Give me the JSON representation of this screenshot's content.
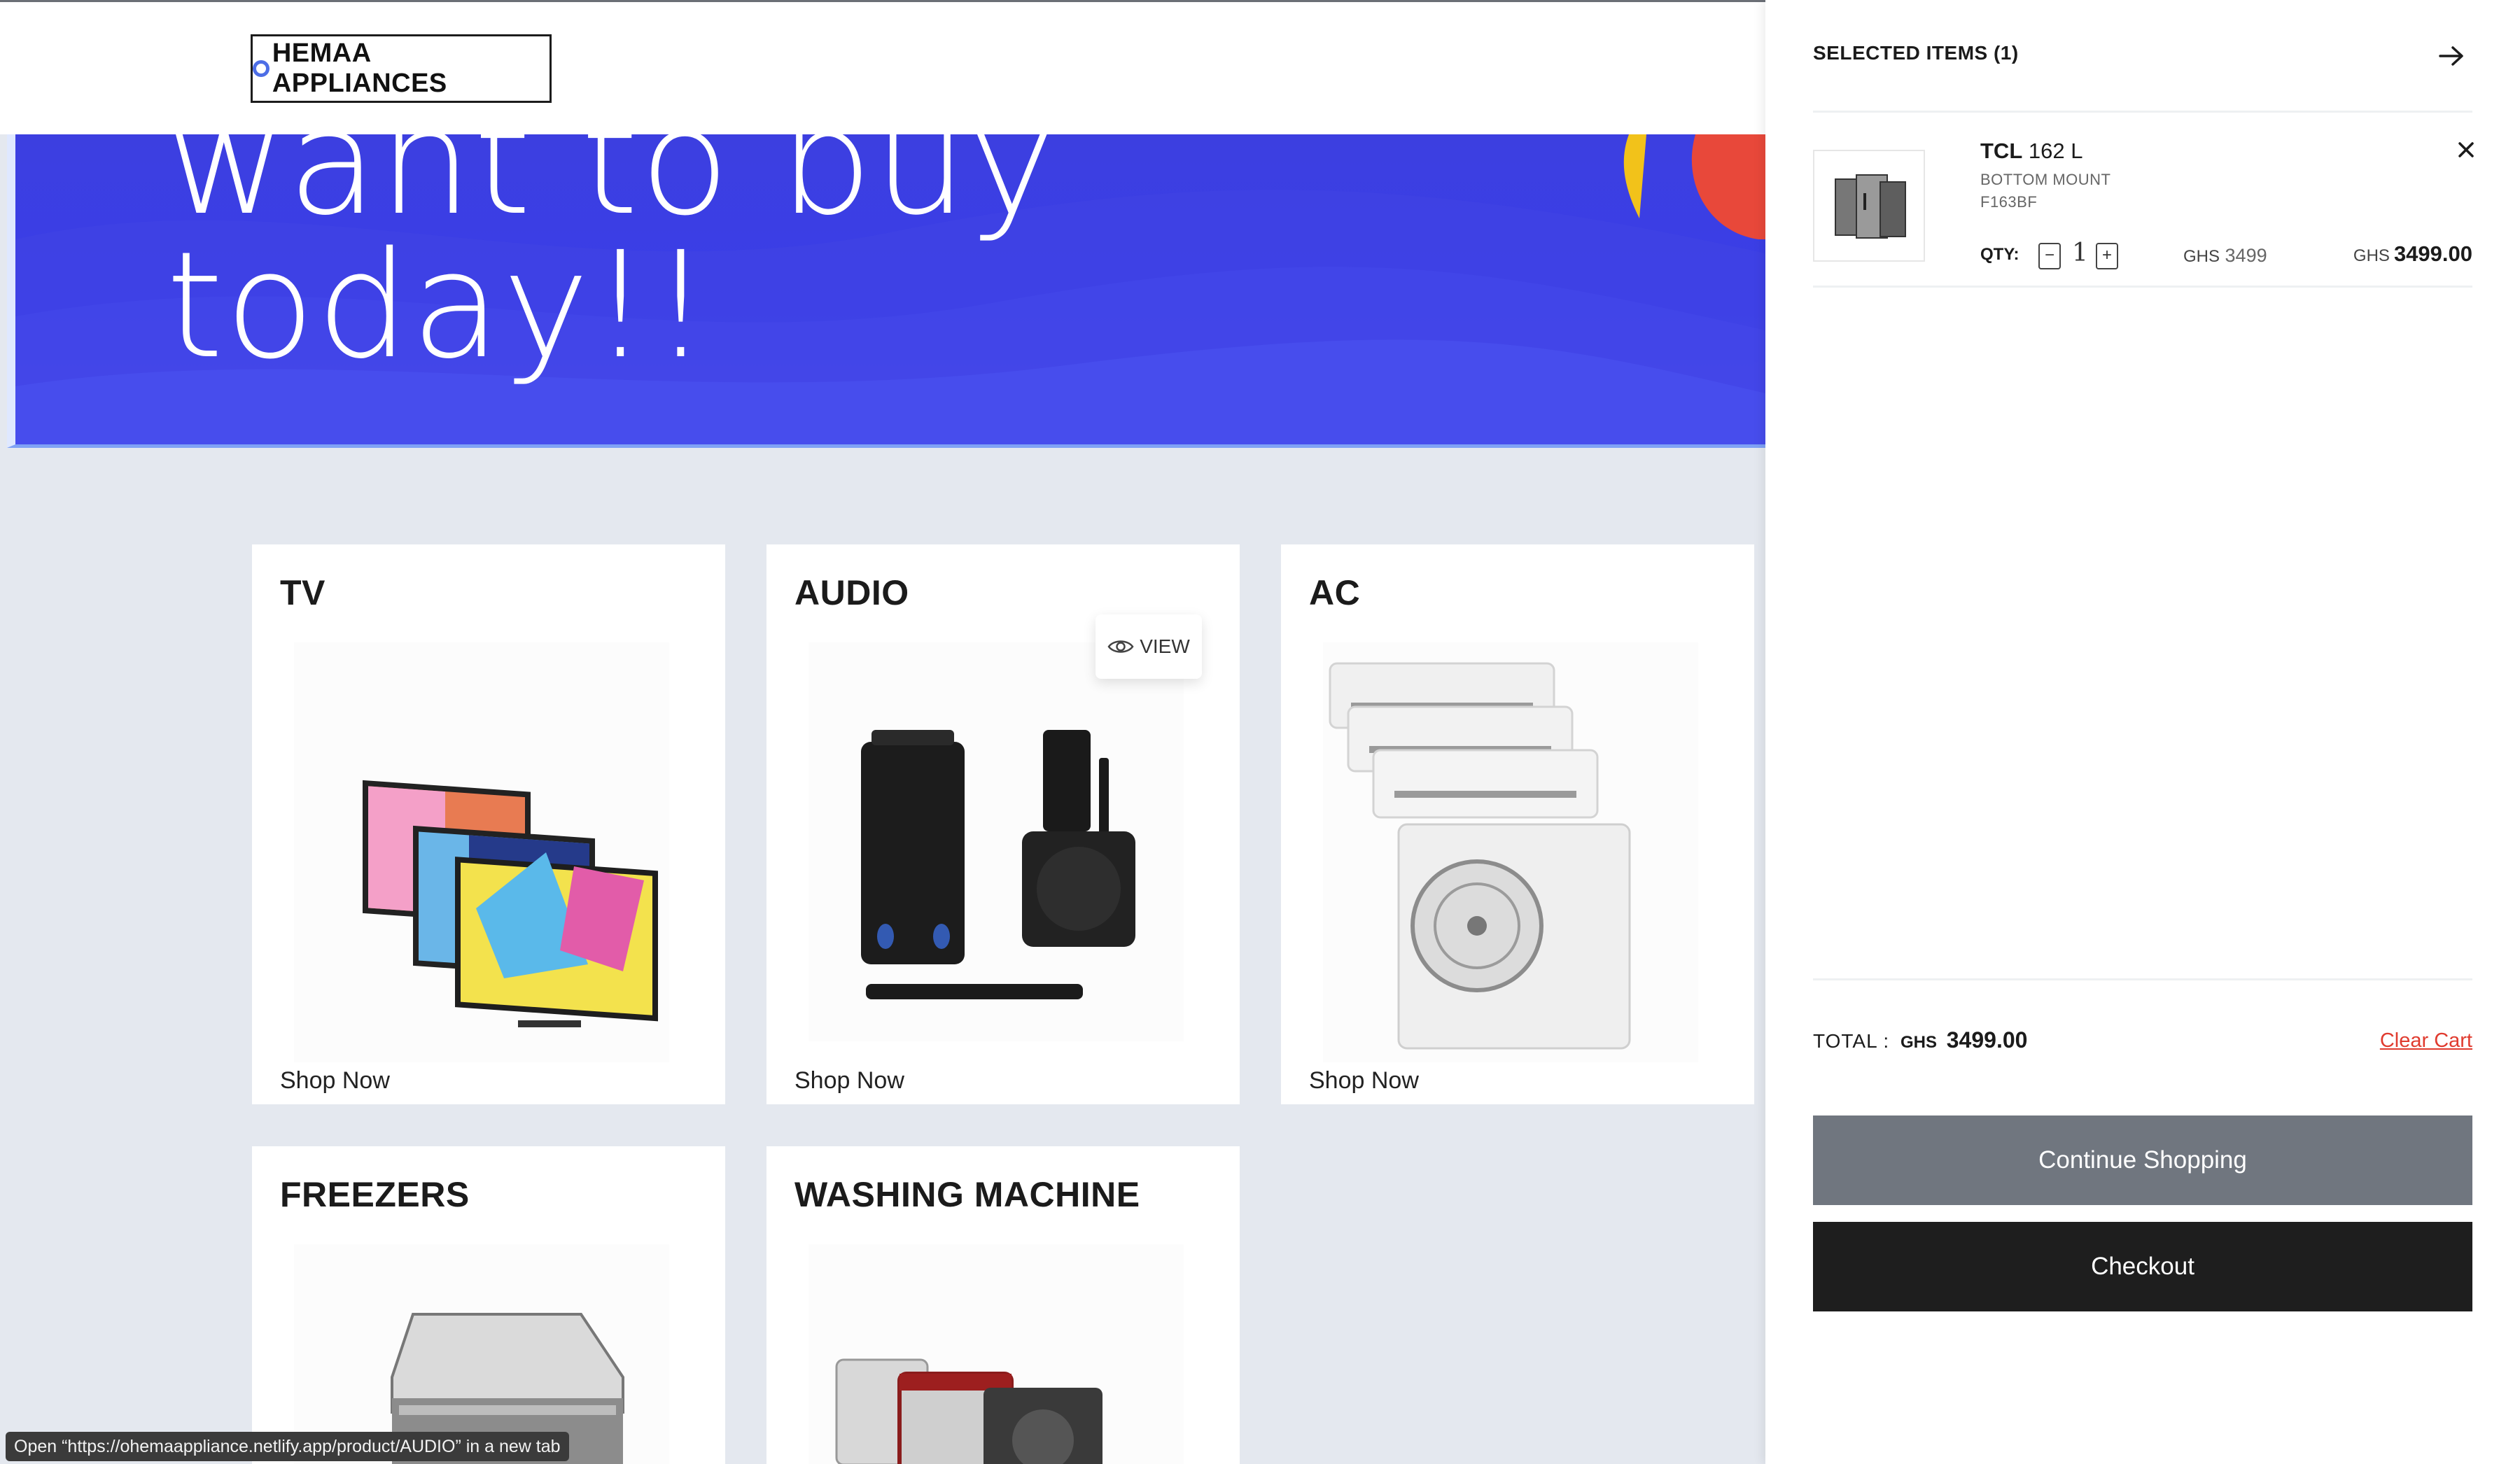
{
  "header": {
    "logo_text": "HEMAA APPLIANCES"
  },
  "hero": {
    "line1": "want to buy",
    "line2": "today!!"
  },
  "categories": [
    {
      "title": "TV",
      "cta": "Shop Now"
    },
    {
      "title": "AUDIO",
      "cta": "Shop Now"
    },
    {
      "title": "AC",
      "cta": "Shop Now"
    },
    {
      "title": "FREEZERS",
      "cta": ""
    },
    {
      "title": "WASHING MACHINE",
      "cta": ""
    }
  ],
  "quick_view": {
    "label": "VIEW"
  },
  "status_bar": {
    "text": "Open “https://ohemaappliance.netlify.app/product/AUDIO” in a new tab"
  },
  "cart": {
    "heading": "SELECTED ITEMS (1)",
    "item": {
      "brand": "TCL",
      "model": " 162 L",
      "sub1": "BOTTOM MOUNT",
      "sub2": "F163BF",
      "qty_label": "QTY:",
      "qty_minus": "−",
      "qty": "1",
      "qty_plus": "+",
      "currency": "GHS",
      "unit_price": "3499",
      "line_total": "3499.00"
    },
    "total_label": "TOTAL :",
    "total_currency": "GHS",
    "total_amount": "3499.00",
    "clear_label": "Clear Cart",
    "continue_label": "Continue Shopping",
    "checkout_label": "Checkout"
  },
  "colors": {
    "hero_blue": "#3a3ee8",
    "cart_continue": "#70767f",
    "cart_checkout": "#1e1e1e",
    "clear_red": "#e03b2f"
  }
}
